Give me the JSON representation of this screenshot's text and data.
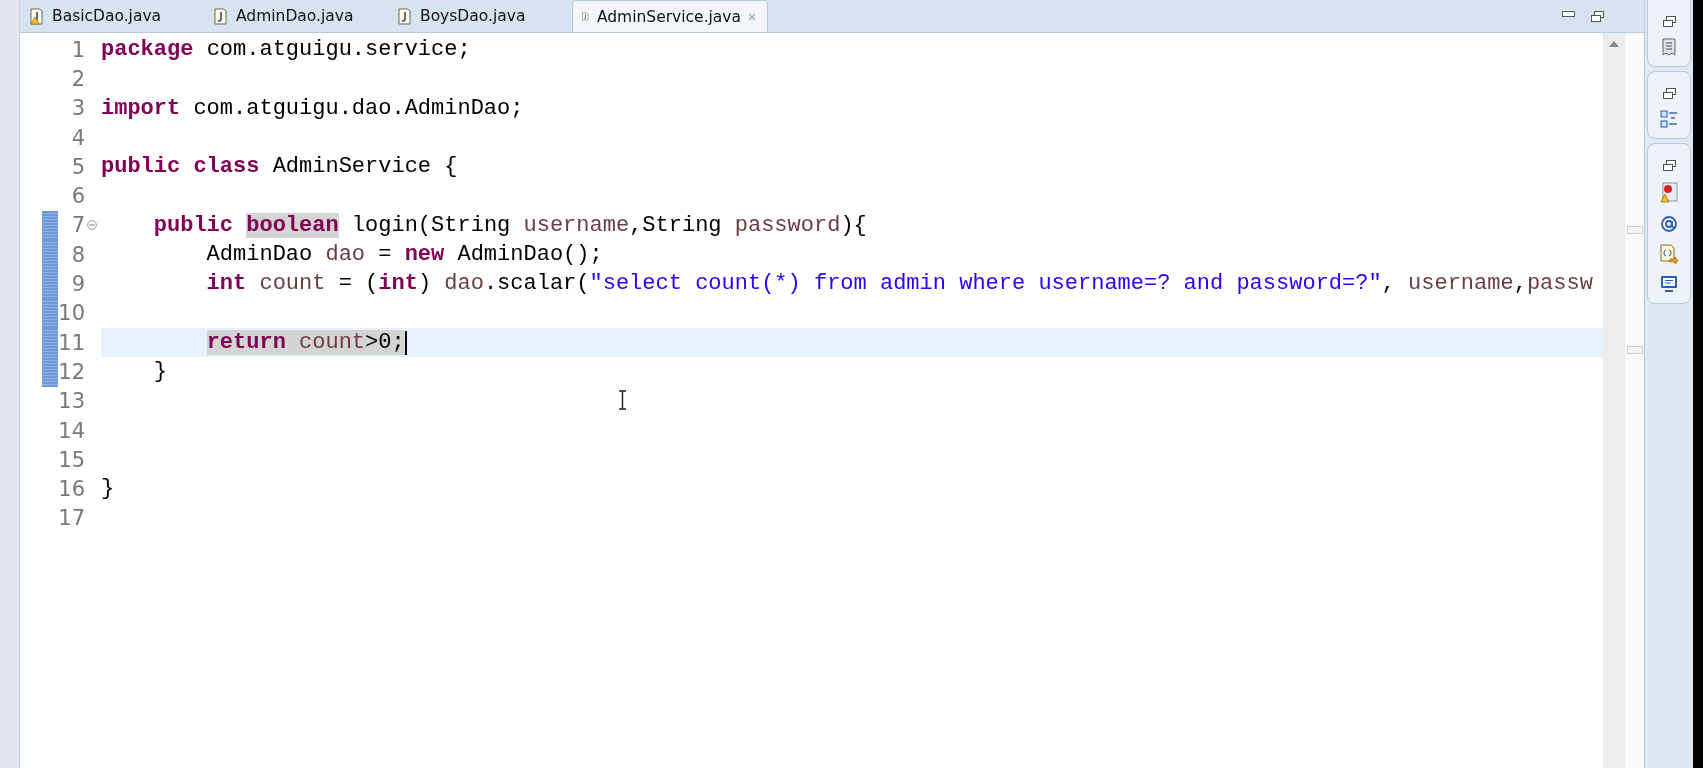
{
  "tabs": [
    {
      "label": "BasicDao.java",
      "selected": false,
      "warning": true
    },
    {
      "label": "AdminDao.java",
      "selected": false,
      "warning": false
    },
    {
      "label": "BoysDao.java",
      "selected": false,
      "warning": false
    },
    {
      "label": "AdminService.java",
      "selected": true,
      "warning": false
    }
  ],
  "editor": {
    "lines": [
      {
        "number": "1",
        "changed": false,
        "current": false,
        "foldable": false,
        "tokens": [
          {
            "text": "package ",
            "kind": "keyword",
            "marked": false
          },
          {
            "text": "com.atguigu.service;",
            "kind": "plain",
            "marked": false
          }
        ]
      },
      {
        "number": "2",
        "changed": false,
        "current": false,
        "foldable": false
      },
      {
        "number": "3",
        "changed": false,
        "current": false,
        "foldable": false,
        "tokens": [
          {
            "text": "import ",
            "kind": "keyword",
            "marked": false
          },
          {
            "text": "com.atguigu.dao.AdminDao;",
            "kind": "plain",
            "marked": false
          }
        ]
      },
      {
        "number": "4",
        "changed": false,
        "current": false,
        "foldable": false
      },
      {
        "number": "5",
        "changed": false,
        "current": false,
        "foldable": false,
        "tokens": [
          {
            "text": "public ",
            "kind": "keyword",
            "marked": false
          },
          {
            "text": "class ",
            "kind": "keyword",
            "marked": false
          },
          {
            "text": "AdminService {",
            "kind": "plain",
            "marked": false
          }
        ]
      },
      {
        "number": "6",
        "changed": false,
        "current": false,
        "foldable": false
      },
      {
        "number": "7",
        "changed": true,
        "current": false,
        "foldable": true,
        "tokens": [
          {
            "text": "    public ",
            "kind": "keyword",
            "marked": false
          },
          {
            "text": "boolean",
            "kind": "keyword",
            "marked": true
          },
          {
            "text": " login(String ",
            "kind": "plain",
            "marked": false
          },
          {
            "text": "username",
            "kind": "variable",
            "marked": false
          },
          {
            "text": ",String ",
            "kind": "plain",
            "marked": false
          },
          {
            "text": "password",
            "kind": "variable",
            "marked": false
          },
          {
            "text": "){",
            "kind": "plain",
            "marked": false
          }
        ]
      },
      {
        "number": "8",
        "changed": true,
        "current": false,
        "foldable": false,
        "tokens": [
          {
            "text": "        AdminDao ",
            "kind": "plain",
            "marked": false
          },
          {
            "text": "dao",
            "kind": "variable",
            "marked": false
          },
          {
            "text": " = ",
            "kind": "plain",
            "marked": false
          },
          {
            "text": "new",
            "kind": "keyword",
            "marked": false
          },
          {
            "text": " AdminDao();",
            "kind": "plain",
            "marked": false
          }
        ]
      },
      {
        "number": "9",
        "changed": true,
        "current": false,
        "foldable": false,
        "tokens": [
          {
            "text": "        int ",
            "kind": "keyword",
            "marked": false
          },
          {
            "text": "count",
            "kind": "variable",
            "marked": false
          },
          {
            "text": " = (",
            "kind": "plain",
            "marked": false
          },
          {
            "text": "int",
            "kind": "keyword",
            "marked": false
          },
          {
            "text": ") ",
            "kind": "plain",
            "marked": false
          },
          {
            "text": "dao",
            "kind": "variable",
            "marked": false
          },
          {
            "text": ".scalar(",
            "kind": "plain",
            "marked": false
          },
          {
            "text": "\"select count(*) from admin where username=? and password=?\"",
            "kind": "string",
            "marked": false
          },
          {
            "text": ", ",
            "kind": "plain",
            "marked": false
          },
          {
            "text": "username",
            "kind": "variable",
            "marked": false
          },
          {
            "text": ",",
            "kind": "plain",
            "marked": false
          },
          {
            "text": "passw",
            "kind": "variable",
            "marked": false
          }
        ]
      },
      {
        "number": "10",
        "changed": true,
        "current": false,
        "foldable": false
      },
      {
        "number": "11",
        "changed": true,
        "current": true,
        "foldable": false,
        "tokens": [
          {
            "text": "        return ",
            "kind": "keyword",
            "marked": true
          },
          {
            "text": "count",
            "kind": "variable",
            "marked": true
          },
          {
            "text": ">0;",
            "kind": "plain",
            "marked": true
          }
        ]
      },
      {
        "number": "12",
        "changed": true,
        "current": false,
        "foldable": false,
        "tokens": [
          {
            "text": "    }",
            "kind": "plain",
            "marked": false
          }
        ]
      },
      {
        "number": "13",
        "changed": false,
        "current": false,
        "foldable": false
      },
      {
        "number": "14",
        "changed": false,
        "current": false,
        "foldable": false
      },
      {
        "number": "15",
        "changed": false,
        "current": false,
        "foldable": false
      },
      {
        "number": "16",
        "changed": false,
        "current": false,
        "foldable": false,
        "tokens": [
          {
            "text": "}",
            "kind": "plain",
            "marked": false
          }
        ]
      },
      {
        "number": "17",
        "changed": false,
        "current": false,
        "foldable": false
      }
    ]
  }
}
